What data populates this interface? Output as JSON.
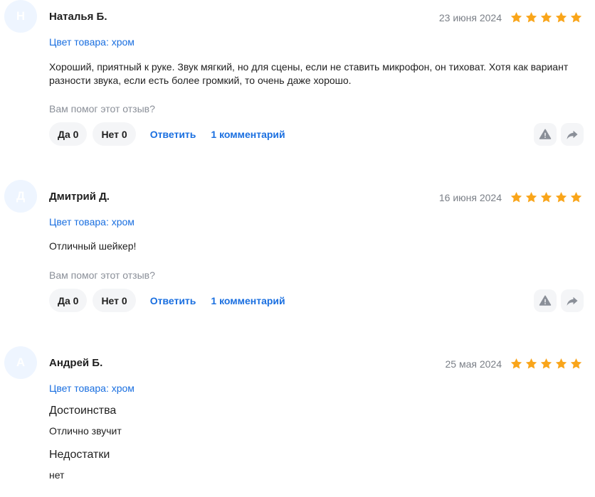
{
  "reviews": [
    {
      "avatar_letter": "Н",
      "author": "Наталья Б.",
      "date": "23 июня 2024",
      "rating": 5,
      "color_label": "Цвет товара: хром",
      "text": "Хороший, приятный к руке. Звук мягкий, но для сцены, если не ставить микрофон, он тиховат. Хотя как вариант разности звука, если есть более громкий, то очень даже хорошо.",
      "helpful_prompt": "Вам помог этот отзыв?",
      "yes_label": "Да 0",
      "no_label": "Нет 0",
      "reply_label": "Ответить",
      "comments_label": "1 комментарий"
    },
    {
      "avatar_letter": "Д",
      "author": "Дмитрий Д.",
      "date": "16 июня 2024",
      "rating": 5,
      "color_label": "Цвет товара: хром",
      "text": "Отличный шейкер!",
      "helpful_prompt": "Вам помог этот отзыв?",
      "yes_label": "Да 0",
      "no_label": "Нет 0",
      "reply_label": "Ответить",
      "comments_label": "1 комментарий"
    },
    {
      "avatar_letter": "А",
      "author": "Андрей Б.",
      "date": "25 мая 2024",
      "rating": 5,
      "color_label": "Цвет товара: хром",
      "pros_title": "Достоинства",
      "pros_text": "Отлично звучит",
      "cons_title": "Недостатки",
      "cons_text": "нет"
    }
  ],
  "colors": {
    "accent": "#1a6fe0",
    "star": "#f9a51a",
    "avatar_bg": "#eef5ff",
    "button_bg": "#f4f5f7"
  },
  "icons": [
    "star-icon",
    "report-icon",
    "share-icon"
  ]
}
